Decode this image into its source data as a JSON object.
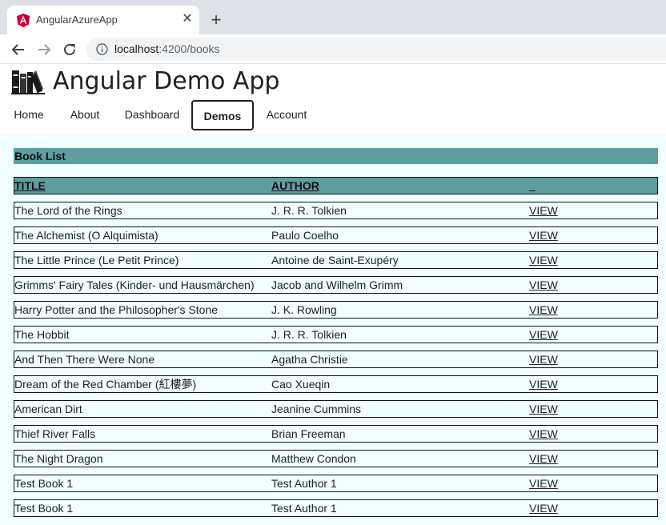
{
  "browser": {
    "tab_title": "AngularAzureApp",
    "url_host": "localhost",
    "url_path": ":4200/books"
  },
  "app": {
    "title": "Angular Demo App"
  },
  "nav": {
    "items": [
      {
        "label": "Home"
      },
      {
        "label": "About"
      },
      {
        "label": "Dashboard"
      },
      {
        "label": "Demos",
        "active": true
      },
      {
        "label": "Account"
      }
    ]
  },
  "books": {
    "heading": "Book List",
    "columns": [
      "TITLE",
      "AUTHOR",
      "_"
    ],
    "rows": [
      {
        "title": "The Lord of the Rings",
        "author": "J. R. R. Tolkien",
        "action": "VIEW"
      },
      {
        "title": "The Alchemist (O Alquimista)",
        "author": "Paulo Coelho",
        "action": "VIEW"
      },
      {
        "title": "The Little Prince (Le Petit Prince)",
        "author": "Antoine de Saint-Exupéry",
        "action": "VIEW"
      },
      {
        "title": "Grimms' Fairy Tales (Kinder- und Hausmärchen)",
        "author": "Jacob and Wilhelm Grimm",
        "action": "VIEW"
      },
      {
        "title": "Harry Potter and the Philosopher's Stone",
        "author": "J. K. Rowling",
        "action": "VIEW"
      },
      {
        "title": "The Hobbit",
        "author": "J. R. R. Tolkien",
        "action": "VIEW"
      },
      {
        "title": "And Then There Were None",
        "author": "Agatha Christie",
        "action": "VIEW"
      },
      {
        "title": "Dream of the Red Chamber (紅樓夢)",
        "author": "Cao Xueqin",
        "action": "VIEW"
      },
      {
        "title": "American Dirt",
        "author": "Jeanine Cummins",
        "action": "VIEW"
      },
      {
        "title": "Thief River Falls",
        "author": "Brian Freeman",
        "action": "VIEW"
      },
      {
        "title": "The Night Dragon",
        "author": "Matthew Condon",
        "action": "VIEW"
      },
      {
        "title": "Test Book 1",
        "author": "Test Author 1",
        "action": "VIEW"
      },
      {
        "title": "Test Book 1",
        "author": "Test Author 1",
        "action": "VIEW"
      }
    ]
  },
  "colors": {
    "header_bg": "#5f9ea0",
    "panel_bg": "#f0ffff",
    "angular_red": "#dd0031"
  },
  "icons": [
    "angular-icon",
    "close-icon",
    "plus-icon",
    "back-arrow-icon",
    "forward-arrow-icon",
    "reload-icon",
    "info-icon",
    "books-logo-icon"
  ]
}
